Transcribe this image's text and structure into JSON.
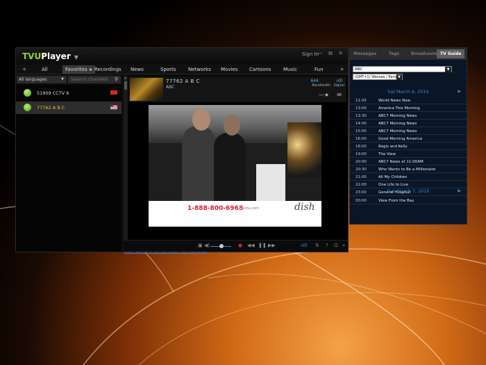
{
  "player": {
    "logo_tvu": "TVU",
    "logo_player": "Player",
    "logo_caret": "▼",
    "sign_in": "Sign In",
    "window_controls": "— ⧉ ✕",
    "tabs": [
      "All",
      "Favorites",
      "Recordings",
      "News",
      "Sports",
      "Networks",
      "Movies",
      "Cartoons",
      "Music",
      "Fun"
    ],
    "favorites_star": "★",
    "lang_filter": "All languages",
    "search_placeholder": "Search channels",
    "channels": [
      {
        "name": "51909 CCTV 6",
        "flag": "cn"
      },
      {
        "name": "77762 A B C",
        "flag": "us"
      }
    ],
    "now_playing": {
      "channel": "77762 A B C",
      "network": "ABC",
      "bandwidth_value": "644",
      "bandwidth_label": "Bandwidth",
      "signal_label": "Signal",
      "signal_bars": "ıılll"
    },
    "ad": {
      "phone": "1-888-800-6968",
      "mid": "Isltu.com",
      "brand": "dish"
    },
    "pvr_link": "Sign up for PVR service - no risk trial",
    "icons": {
      "favorite": "star-icon",
      "mail": "mail-icon",
      "search": "search-icon"
    }
  },
  "guide": {
    "tabs": [
      "Messages",
      "Tags",
      "Broadcaster",
      "TV Guide"
    ],
    "channel_select": "ABC",
    "timezone_select": "(GMT+1) Warsaw / Paris",
    "dates": [
      "Sat March 6, 2010",
      "Sun March 7, 2010"
    ],
    "schedule_day1": [
      {
        "time": "11:05",
        "title": "World News Now"
      },
      {
        "time": "13:00",
        "title": "America This Morning"
      },
      {
        "time": "13:30",
        "title": "ABC7 Morning News"
      },
      {
        "time": "14:00",
        "title": "ABC7 Morning News"
      },
      {
        "time": "15:00",
        "title": "ABC7 Morning News"
      },
      {
        "time": "16:00",
        "title": "Good Morning America"
      },
      {
        "time": "18:00",
        "title": "Regis and Kelly"
      },
      {
        "time": "19:00",
        "title": "The View"
      },
      {
        "time": "20:00",
        "title": "ABC7 News at 11:00AM"
      },
      {
        "time": "20:30",
        "title": "Who Wants to Be a Millionaire"
      },
      {
        "time": "21:00",
        "title": "All My Children"
      },
      {
        "time": "22:00",
        "title": "One Life to Live"
      },
      {
        "time": "23:00",
        "title": "General Hospital"
      }
    ],
    "schedule_day2": [
      {
        "time": "00:00",
        "title": "View From the Bay"
      }
    ],
    "accent_color": "#3d86d9"
  }
}
